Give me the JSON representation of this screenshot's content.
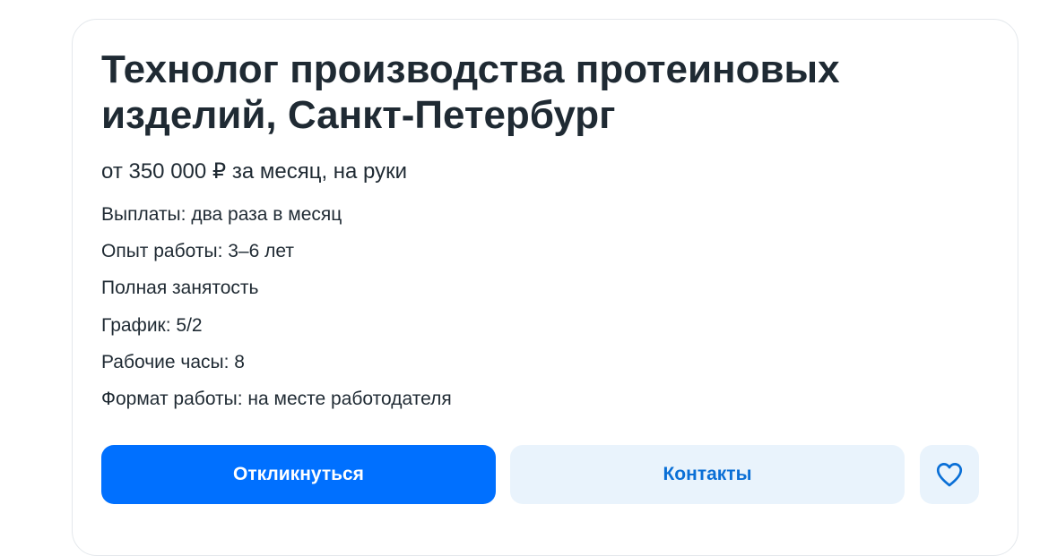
{
  "vacancy": {
    "title": "Технолог производства протеиновых изделий, Санкт-Петербург",
    "salary": "от 350 000 ₽ за месяц, на руки",
    "details": [
      "Выплаты: два раза в месяц",
      "Опыт работы: 3–6 лет",
      "Полная занятость",
      "График: 5/2",
      "Рабочие часы: 8",
      "Формат работы: на месте работодателя"
    ]
  },
  "actions": {
    "respond_label": "Откликнуться",
    "contacts_label": "Контакты",
    "favorite_icon": "heart-icon"
  },
  "colors": {
    "primary": "#0070ff",
    "secondary_bg": "#e9f3fc",
    "secondary_text": "#0a6fd6",
    "text": "#1f2a33"
  }
}
